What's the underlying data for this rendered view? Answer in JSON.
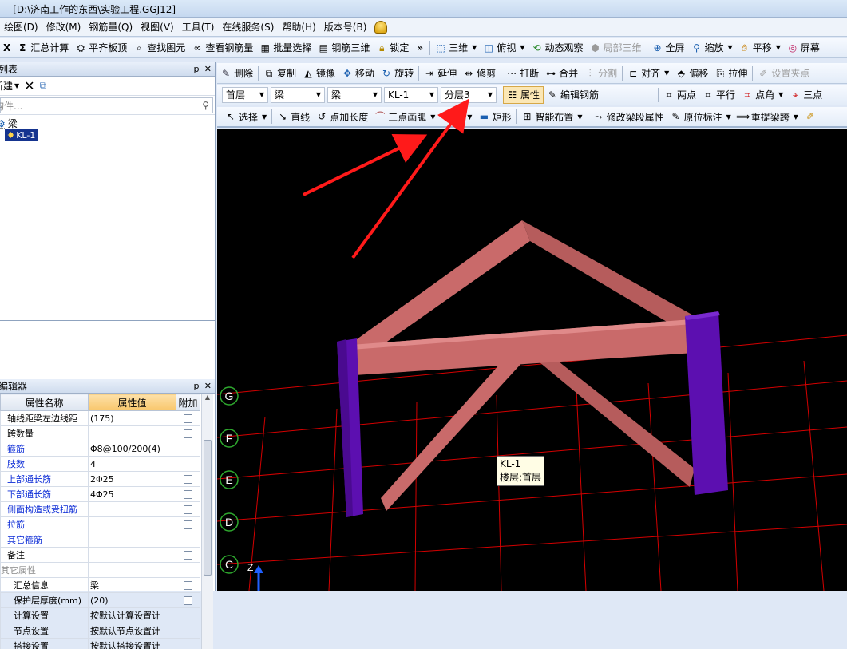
{
  "title": "- [D:\\济南工作的东西\\实验工程.GGJ12]",
  "menu": [
    "绘图(D)",
    "修改(M)",
    "钢筋量(Q)",
    "视图(V)",
    "工具(T)",
    "在线服务(S)",
    "帮助(H)",
    "版本号(B)"
  ],
  "toolbar1": {
    "items": [
      "X",
      "汇总计算",
      "平齐板顶",
      "查找图元",
      "查看钢筋量",
      "批量选择",
      "钢筋三维",
      "锁定"
    ],
    "items2": [
      "三维",
      "俯视",
      "动态观察",
      "局部三维",
      "全屏",
      "缩放",
      "平移",
      "屏幕"
    ],
    "more": "»"
  },
  "toolbar2": [
    "删除",
    "复制",
    "镜像",
    "移动",
    "旋转",
    "延伸",
    "修剪",
    "打断",
    "合并",
    "分割",
    "对齐",
    "偏移",
    "拉伸",
    "设置夹点"
  ],
  "toolbar3": {
    "floor": "首层",
    "type1": "梁",
    "type2": "梁",
    "element": "KL-1",
    "layer": "分层3",
    "attr": "属性",
    "edit_rebar": "编辑钢筋",
    "tools": [
      "两点",
      "平行",
      "点角",
      "三点"
    ]
  },
  "toolbar4": [
    "选择",
    "直线",
    "点加长度",
    "三点画弧",
    "矩形",
    "智能布置",
    "修改梁段属性",
    "原位标注",
    "重提梁跨"
  ],
  "left": {
    "list_title": "列表",
    "new_btn": "新建",
    "search_placeholder": "构件...",
    "tree_root": "梁",
    "tree_child": "KL-1",
    "editor_title": "编辑器",
    "col_name": "属性名称",
    "col_value": "属性值",
    "col_add": "附加",
    "rows": [
      {
        "name": "轴线距梁左边线距",
        "value": "(175)",
        "blue": false,
        "cb": true
      },
      {
        "name": "跨数量",
        "value": "",
        "blue": false,
        "cb": true
      },
      {
        "name": "箍筋",
        "value": "Φ8@100/200(4)",
        "blue": true,
        "cb": true
      },
      {
        "name": "肢数",
        "value": "4",
        "blue": true,
        "cb": false
      },
      {
        "name": "上部通长筋",
        "value": "2Φ25",
        "blue": true,
        "cb": true
      },
      {
        "name": "下部通长筋",
        "value": "4Φ25",
        "blue": true,
        "cb": true
      },
      {
        "name": "侧面构造或受扭筋",
        "value": "",
        "blue": true,
        "cb": true
      },
      {
        "name": "拉筋",
        "value": "",
        "blue": true,
        "cb": true
      },
      {
        "name": "其它箍筋",
        "value": "",
        "blue": true,
        "cb": false
      },
      {
        "name": "备注",
        "value": "",
        "blue": false,
        "cb": true
      },
      {
        "name": "其它属性",
        "value": "",
        "blue": false,
        "cb": false
      },
      {
        "name": "汇总信息",
        "value": "梁",
        "blue": false,
        "cb": true
      },
      {
        "name": "保护层厚度(mm)",
        "value": "(20)",
        "blue": false,
        "cb": true
      },
      {
        "name": "计算设置",
        "value": "按默认计算设置计",
        "blue": false,
        "cb": false
      },
      {
        "name": "节点设置",
        "value": "按默认节点设置计",
        "blue": false,
        "cb": false
      },
      {
        "name": "搭接设置",
        "value": "按默认搭接设置计",
        "blue": false,
        "cb": false
      }
    ]
  },
  "viewport": {
    "axes": [
      "G",
      "F",
      "E",
      "D",
      "C"
    ],
    "axis_z": "Z",
    "tooltip_line1": "KL-1",
    "tooltip_line2": "楼层:首层"
  },
  "colors": {
    "beam": "#c96a6a",
    "column": "#5c0fb0",
    "grid": "#d40000",
    "axis_circle": "#2ea82e",
    "arrow": "#ff1a1a"
  }
}
